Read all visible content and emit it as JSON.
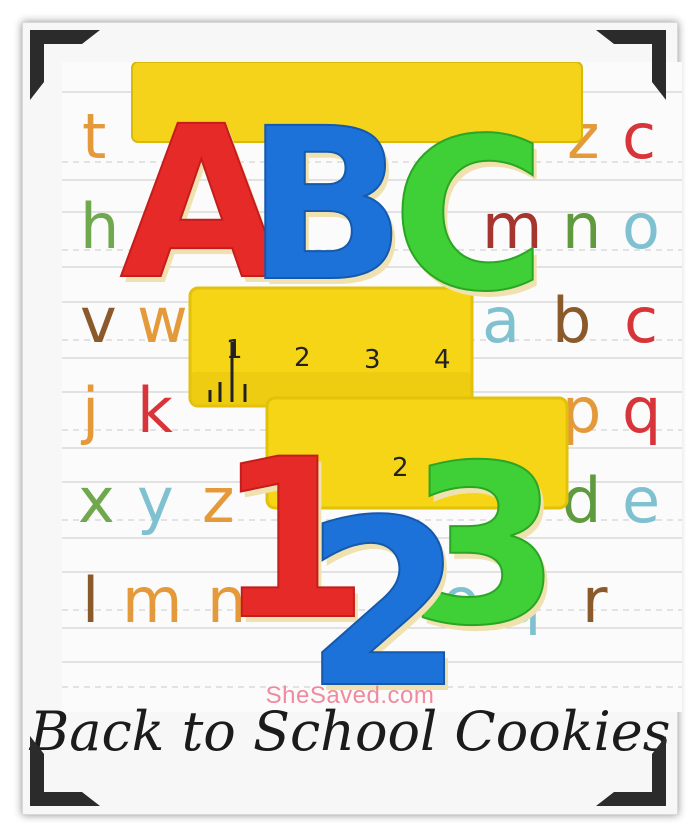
{
  "watermark": "SheSaved.com",
  "title": "Back to School Cookies",
  "cookies": {
    "letters": [
      "A",
      "B",
      "C"
    ],
    "numbers": [
      "1",
      "2",
      "3"
    ]
  },
  "ruler_marks": [
    "1",
    "2",
    "3",
    "4"
  ],
  "alphabet_rows": [
    [
      "t",
      "z",
      "c"
    ],
    [
      "h",
      "m",
      "n",
      "o"
    ],
    [
      "v",
      "w",
      "a",
      "b",
      "c"
    ],
    [
      "j",
      "k",
      "p",
      "q"
    ],
    [
      "x",
      "y",
      "z",
      "d",
      "e"
    ],
    [
      "l",
      "m",
      "n",
      "o",
      "q",
      "r"
    ]
  ],
  "colors": {
    "red": "#e52a27",
    "blue": "#1c72d8",
    "green": "#3fcf36",
    "yellow": "#f2d40e",
    "frame_corner": "#2b2b2b",
    "watermark": "#f08a9c"
  }
}
